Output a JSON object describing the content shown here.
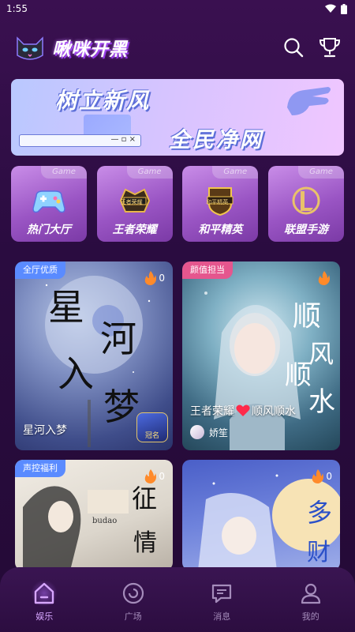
{
  "status_bar": {
    "time": "1:55"
  },
  "header": {
    "title": "啾咪开黑",
    "search_icon": "search-icon",
    "trophy_icon": "trophy-icon"
  },
  "banner": {
    "line1": "树立新风",
    "line2": "全民净网",
    "window_controls": "— ▫ ×"
  },
  "categories": [
    {
      "label": "热门大厅",
      "tab": "Game",
      "icon": "gamepad-icon"
    },
    {
      "label": "王者荣耀",
      "tab": "Game",
      "icon": "honor-of-kings-icon",
      "badge": "王者荣耀"
    },
    {
      "label": "和平精英",
      "tab": "Game",
      "icon": "peace-elite-icon",
      "badge": "和平精英"
    },
    {
      "label": "联盟手游",
      "tab": "Game",
      "icon": "league-icon"
    }
  ],
  "rooms": [
    {
      "tag": "全厅优质",
      "heat": "0",
      "title": "星河入梦",
      "art_text": [
        "星",
        "河",
        "入",
        "梦"
      ],
      "badge": "冠名"
    },
    {
      "tag": "颜值担当",
      "heat": "",
      "title_left": "王者荣耀",
      "title_right": "顺风顺水",
      "host": "娇笙",
      "art_text": [
        "顺",
        "风",
        "顺",
        "水"
      ]
    },
    {
      "tag": "声控福利",
      "heat": "0",
      "art_text": [
        "征",
        "情"
      ],
      "small_text": "budao"
    },
    {
      "tag": "",
      "heat": "0",
      "art_text": [
        "多",
        "财"
      ]
    }
  ],
  "tabbar": [
    {
      "label": "娱乐",
      "icon": "home-icon",
      "active": true
    },
    {
      "label": "广场",
      "icon": "square-icon",
      "active": false
    },
    {
      "label": "消息",
      "icon": "message-icon",
      "active": false
    },
    {
      "label": "我的",
      "icon": "profile-icon",
      "active": false
    }
  ],
  "colors": {
    "accent": "#c57cff",
    "tag_blue": "#5a8bff",
    "tag_pink": "#e5568e"
  }
}
